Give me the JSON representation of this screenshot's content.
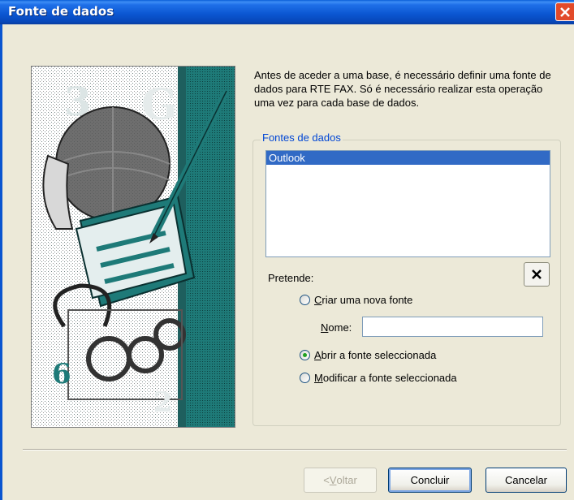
{
  "window": {
    "title": "Fonte de dados"
  },
  "intro": {
    "text": "Antes de aceder a uma base, é necessário definir uma fonte de dados para RTE FAX. Só é necessário realizar esta operação uma vez para cada base de dados."
  },
  "group": {
    "legend": "Fontes de dados"
  },
  "list": {
    "items": [
      "Outlook"
    ],
    "selected": "Outlook"
  },
  "options": {
    "prompt": "Pretende:",
    "create_key": "C",
    "create_rest": "riar uma nova fonte",
    "name_key": "N",
    "name_rest": "ome:",
    "name_value": "",
    "open_key": "A",
    "open_rest": "brir a fonte seleccionada",
    "modify_key": "M",
    "modify_rest": "odificar a fonte seleccionada",
    "selected_option": "open"
  },
  "buttons": {
    "back_prefix": "< ",
    "back_key": "V",
    "back_rest": "oltar",
    "finish": "Concluir",
    "cancel": "Cancelar"
  },
  "colors": {
    "titlebar": "#0A55D0",
    "accent": "#316AC5",
    "legend": "#0046D5",
    "art_teal": "#1E7A78"
  }
}
